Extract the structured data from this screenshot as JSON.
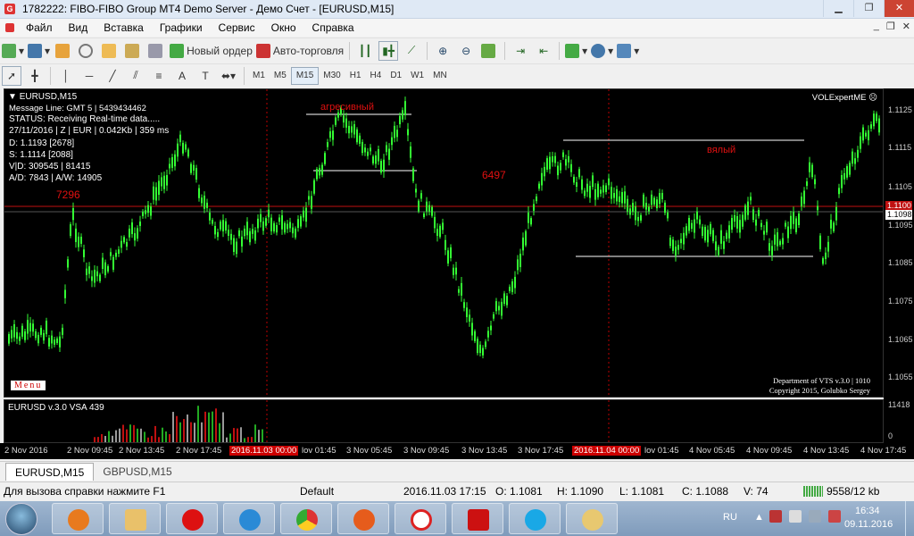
{
  "window": {
    "title": "1782222: FIBO-FIBO Group MT4 Demo Server - Демо Счет - [EURUSD,M15]",
    "min_btn": "▁",
    "max_btn": "❐",
    "close_btn": "✕"
  },
  "menu": {
    "items": [
      "Файл",
      "Вид",
      "Вставка",
      "Графики",
      "Сервис",
      "Окно",
      "Справка"
    ],
    "mdi": [
      "_",
      "❐",
      "✕"
    ]
  },
  "toolbar": {
    "new_order": "Новый ордер",
    "auto_trading": "Авто-торговля"
  },
  "timeframes": [
    "M1",
    "M5",
    "M15",
    "M30",
    "H1",
    "H4",
    "D1",
    "W1",
    "MN"
  ],
  "active_timeframe": "M15",
  "chart": {
    "symbol": "EURUSD,M15",
    "info_lines": [
      "Message Line: GMT 5 | 5439434462",
      "STATUS:  Receiving Real-time data.....",
      "27/11/2016 | Z | EUR | 0.042Kb | 359 ms",
      "D: 1.1193  [2678]",
      "S: 1.1114  [2088]",
      "V|D: 309545 | 81415",
      "A/D: 7843 | A/W: 14905"
    ],
    "expert": "VOLExpertME ☹",
    "label_7296": "7296",
    "label_6497": "6497",
    "label_agr": "агресивный",
    "label_vyal": "вялый",
    "menu_btn": "Menu",
    "dept": "Department of VTS  v.3.0 | 1010",
    "copyright": "Copyright 2015, Golubko Sergey",
    "price_labels": [
      "1.1125",
      "1.1115",
      "1.1105",
      "1.1095",
      "1.1085",
      "1.1075",
      "1.1065",
      "1.1055"
    ],
    "bid_tag": "1.1100",
    "ask_tag": "1.1098",
    "subchart_title": "EURUSD v.3.0 VSA 439",
    "sub_labels": [
      "11418",
      "0"
    ],
    "time_labels": [
      "2 Nov 2016",
      "2 Nov 09:45",
      "2 Nov 13:45",
      "2 Nov 17:45",
      "2016.11.03 00:00",
      "lov 01:45",
      "3 Nov 05:45",
      "3 Nov 09:45",
      "3 Nov 13:45",
      "3 Nov 17:45",
      "2016.11.04 00:00",
      "lov 01:45",
      "4 Nov 05:45",
      "4 Nov 09:45",
      "4 Nov 13:45",
      "4 Nov 17:45"
    ]
  },
  "tabs": [
    "EURUSD,M15",
    "GBPUSD,M15"
  ],
  "status": {
    "help": "Для вызова справки нажмите F1",
    "profile": "Default",
    "time": "2016.11.03 17:15",
    "o": "O: 1.1081",
    "h": "H: 1.1090",
    "l": "L: 1.1081",
    "c": "C: 1.1088",
    "v": "V: 74",
    "traffic": "9558/12 kb"
  },
  "taskbar": {
    "lang": "RU",
    "clock_time": "16:34",
    "clock_date": "09.11.2016"
  },
  "colors": {
    "bull": "#33ff33",
    "chart_bg": "#000000",
    "red_label": "#e01010",
    "bid_line": "#d01010"
  }
}
